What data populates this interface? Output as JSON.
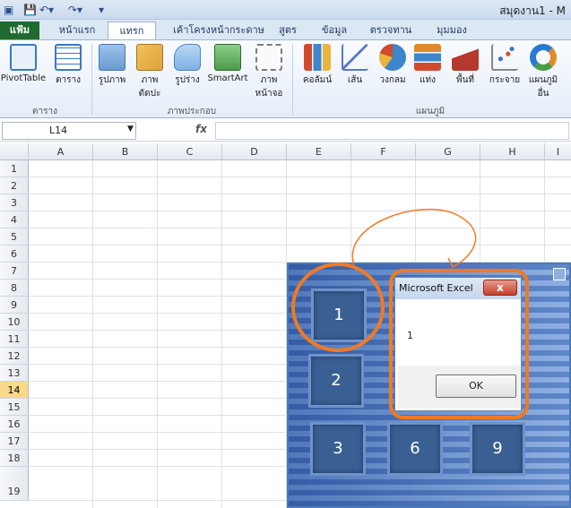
{
  "titlebar": {
    "title": "สมุดงาน1 - M",
    "qa_icons": [
      "save-icon",
      "undo-icon",
      "redo-icon",
      "customize-icon"
    ]
  },
  "tabs": [
    "แฟ้ม",
    "หน้าแรก",
    "แทรก",
    "เค้าโครงหน้ากระดาษ",
    "สูตร",
    "ข้อมูล",
    "ตรวจทาน",
    "มุมมอง"
  ],
  "active_tab": "แทรก",
  "ribbon": {
    "buttons": [
      {
        "label": "PivotTable",
        "icon": "pivottable-icon",
        "color": "#3a78c4"
      },
      {
        "label": "ตาราง",
        "icon": "table-icon",
        "color": "#3a78c4"
      },
      {
        "label": "รูปภาพ",
        "icon": "picture-icon",
        "color": "#6a9bd1"
      },
      {
        "label": "ภาพ",
        "label2": "ตัดปะ",
        "icon": "clipart-icon",
        "color": "#e0a13a"
      },
      {
        "label": "รูปร่าง",
        "icon": "shapes-icon",
        "color": "#7fb1e3"
      },
      {
        "label": "SmartArt",
        "icon": "smartart-icon",
        "color": "#4c9a4a"
      },
      {
        "label": "ภาพ",
        "label2": "หน้าจอ",
        "icon": "screenshot-icon",
        "color": "#7d7d7d"
      },
      {
        "label": "คอลัมน์",
        "icon": "column-chart-icon",
        "color": "#d04a2d"
      },
      {
        "label": "เส้น",
        "icon": "line-chart-icon",
        "color": "#5a78c9"
      },
      {
        "label": "วงกลม",
        "icon": "pie-chart-icon",
        "color": "#3d86cc"
      },
      {
        "label": "แท่ง",
        "icon": "bar-chart-icon",
        "color": "#e28a2a"
      },
      {
        "label": "พื้นที่",
        "icon": "area-chart-icon",
        "color": "#b53a2d"
      },
      {
        "label": "กระจาย",
        "icon": "scatter-chart-icon",
        "color": "#3f6fc0"
      },
      {
        "label": "แผนภูมิ",
        "label2": "อื่น",
        "icon": "other-chart-icon",
        "color": "#2a7bd0"
      }
    ],
    "groups": [
      "ตาราง",
      "ภาพประกอบ",
      "แผนภูมิ"
    ]
  },
  "formula_bar": {
    "name_box": "L14",
    "fx": "fx",
    "formula": ""
  },
  "sheet": {
    "columns": [
      "A",
      "B",
      "C",
      "D",
      "E",
      "F",
      "G",
      "H",
      "I"
    ],
    "rows": [
      "1",
      "2",
      "3",
      "4",
      "5",
      "6",
      "7",
      "8",
      "9",
      "10",
      "11",
      "12",
      "13",
      "14",
      "15",
      "16",
      "17",
      "18",
      "19"
    ],
    "selected_row": "14"
  },
  "userform": {
    "buttons": [
      "1",
      "2",
      "3",
      "6",
      "9"
    ]
  },
  "dialog": {
    "title": "Microsoft Excel",
    "close": "x",
    "message": "1",
    "ok": "OK"
  },
  "annotation_color": "#f07a23"
}
